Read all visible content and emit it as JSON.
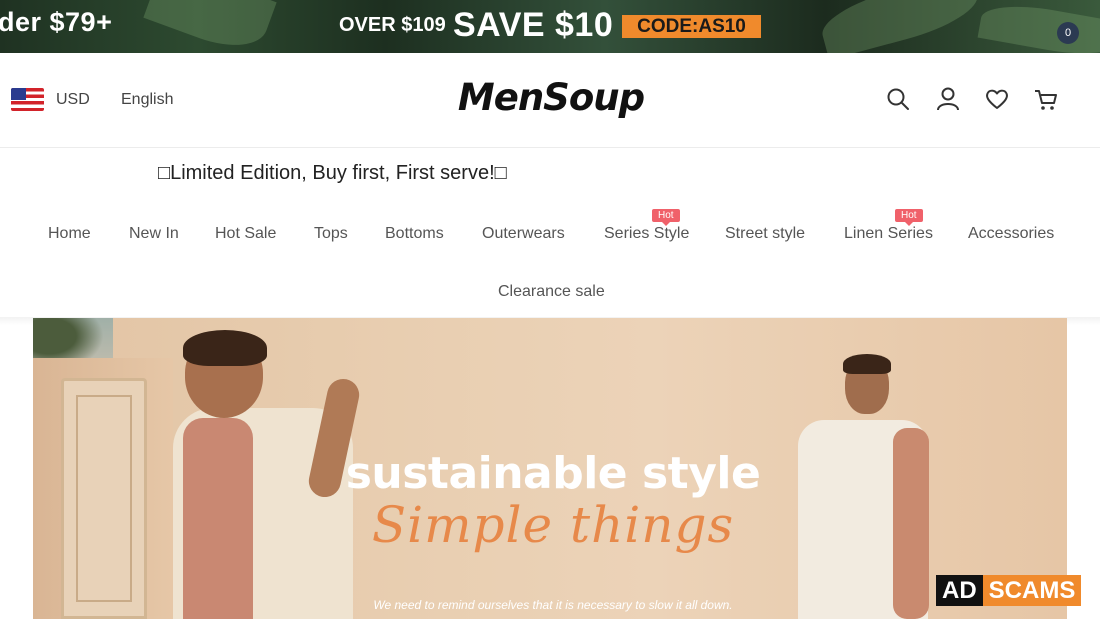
{
  "promo": {
    "left_text": "der $79+",
    "over_text": "OVER $109",
    "save_text": "SAVE $10",
    "code_text": "CODE:AS10"
  },
  "header": {
    "currency": "USD",
    "language": "English",
    "logo": "MenSoup",
    "cart_count": "0"
  },
  "announcement": "□Limited Edition, Buy first, First serve!□",
  "nav": {
    "items": [
      {
        "label": "Home"
      },
      {
        "label": "New In"
      },
      {
        "label": "Hot Sale"
      },
      {
        "label": "Tops"
      },
      {
        "label": "Bottoms"
      },
      {
        "label": "Outerwears"
      },
      {
        "label": "Series Style",
        "badge": "Hot"
      },
      {
        "label": "Street style"
      },
      {
        "label": "Linen Series",
        "badge": "Hot"
      },
      {
        "label": "Accessories"
      },
      {
        "label": "Clearance sale"
      }
    ]
  },
  "hero": {
    "title": "sustainable style",
    "script": "Simple things",
    "caption": "We need to remind ourselves that it is necessary to slow it all down."
  },
  "watermark": {
    "left": "AD",
    "right": "SCAMS"
  },
  "colors": {
    "promo_code_bg": "#f08a2c",
    "hot_badge": "#f0616a",
    "cart_badge": "#2b3a52"
  },
  "icons": [
    "flag-us-icon",
    "search-icon",
    "user-icon",
    "heart-icon",
    "cart-icon"
  ]
}
